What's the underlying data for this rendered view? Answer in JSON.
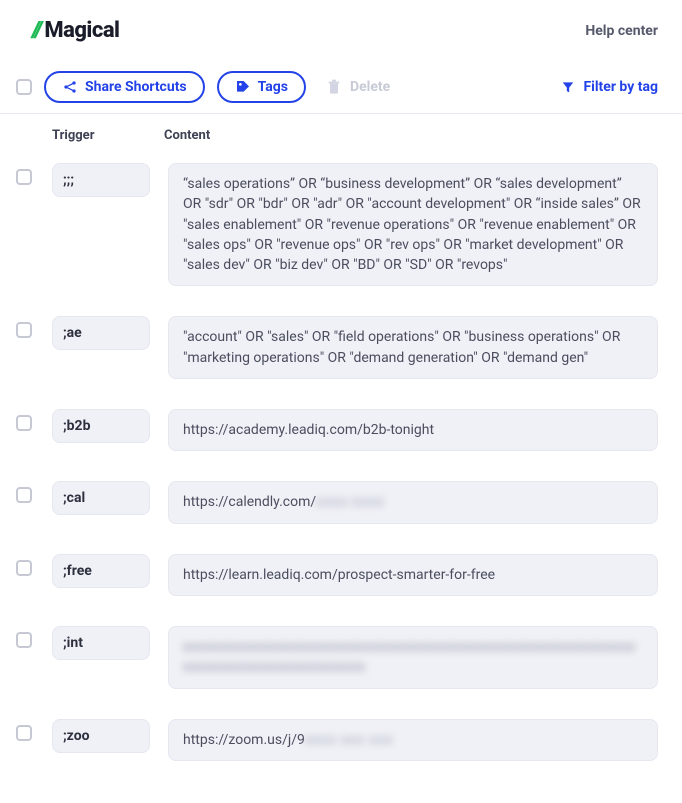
{
  "brand": {
    "slashes": "//",
    "name": "Magical"
  },
  "header": {
    "help": "Help center"
  },
  "toolbar": {
    "share_label": "Share Shortcuts",
    "tags_label": "Tags",
    "delete_label": "Delete",
    "filter_label": "Filter by tag"
  },
  "columns": {
    "trigger": "Trigger",
    "content": "Content"
  },
  "rows": [
    {
      "trigger": ";;;",
      "content": "“sales operations” OR “business development” OR “sales development” OR \"sdr\" OR \"bdr\" OR \"adr\" OR \"account development\" OR “inside sales” OR \"sales enablement\" OR \"revenue operations\" OR \"revenue enablement\" OR \"sales ops\" OR \"revenue ops\" OR \"rev ops\" OR \"market development\" OR \"sales dev\" OR \"biz dev\" OR \"BD\" OR \"SD\" OR \"revops\""
    },
    {
      "trigger": ";ae",
      "content": "\"account\" OR \"sales\" OR \"field operations\" OR \"business operations\" OR \"marketing operations\" OR \"demand generation\" OR \"demand gen\""
    },
    {
      "trigger": ";b2b",
      "content": "https://academy.leadiq.com/b2b-tonight"
    },
    {
      "trigger": ";cal",
      "content": "https://calendly.com/",
      "redacted_tail": "xxxx-xxxx"
    },
    {
      "trigger": ";free",
      "content": "https://learn.leadiq.com/prospect-smarter-for-free"
    },
    {
      "trigger": ";int",
      "redacted_full": "xxxxxxxxxxxxxxxxxxxxxxxxxxxxxxxxxxxxxxxxxxxxxxxxxxxxxxxxxxxxxxxxxxxxxxxxxxxxxxxx"
    },
    {
      "trigger": ";zoo",
      "content": "https://zoom.us/j/9",
      "redacted_tail": "xxxx xxx xxx"
    }
  ]
}
